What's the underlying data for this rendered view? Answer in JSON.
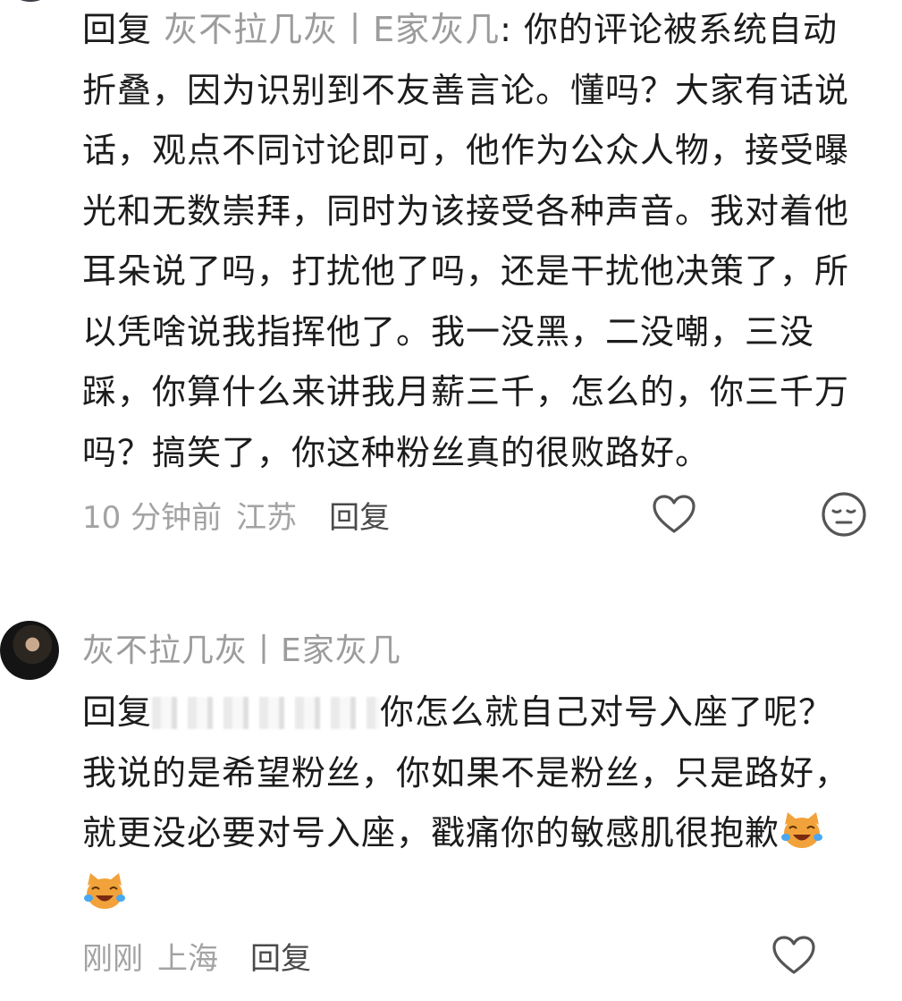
{
  "comment1": {
    "reply_prefix": "回复",
    "mention": "灰不拉几灰丨E家灰几",
    "colon": ":",
    "text": "你的评论被系统自动折叠，因为识别到不友善言论。懂吗？大家有话说话，观点不同讨论即可，他作为公众人物，接受曝光和无数崇拜，同时为该接受各种声音。我对着他耳朵说了吗，打扰他了吗，还是干扰他决策了，所以凭啥说我指挥他了。我一没黑，二没嘲，三没踩，你算什么来讲我月薪三千，怎么的，你三千万吗？搞笑了，你这种粉丝真的很败路好。",
    "time": "10 分钟前",
    "location": "江苏",
    "reply_label": "回复",
    "icons": [
      "heart-outline-icon",
      "expressionless-face-icon"
    ]
  },
  "comment2": {
    "username": "灰不拉几灰丨E家灰几",
    "reply_prefix": "回复",
    "text_after_mention": "你怎么就自己对号入座了呢？我说的是希望粉丝，你如果不是粉丝，只是路好，就更没必要对号入座，戳痛你的敏感肌很抱歉",
    "time": "刚刚",
    "location": "上海",
    "reply_label": "回复",
    "icons": [
      "heart-outline-icon",
      "laughing-crying-cat-emoji",
      "avatar"
    ]
  },
  "colors": {
    "text_primary": "#1c1c1c",
    "text_muted": "#9c9c9c",
    "meta_gray": "#a3a3a3",
    "icon_gray": "#555555"
  }
}
